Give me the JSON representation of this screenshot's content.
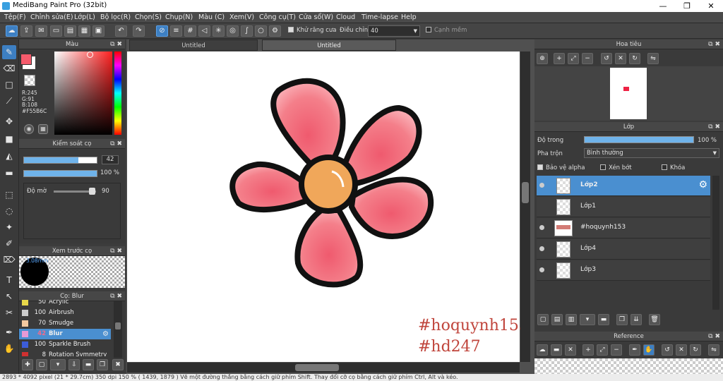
{
  "window": {
    "title": "MediBang Paint Pro (32bit)",
    "minimize": "—",
    "maximize": "❐",
    "close": "✕"
  },
  "menu": [
    "Tệp(F)",
    "Chỉnh sửa(E)",
    "Lớp(L)",
    "Bộ lọc(R)",
    "Chọn(S)",
    "Chụp(N)",
    "Màu (C)",
    "Xem(V)",
    "Công cụ(T)",
    "Cửa sổ(W)",
    "Cloud",
    "Time-lapse",
    "Help"
  ],
  "toolbar": {
    "antialias_label": "Khử răng cưa",
    "antialias_checked": true,
    "correction_label": "Điều chỉnh",
    "correction_value": "40",
    "edge_label": "Cạnh mềm",
    "edge_checked": false
  },
  "color_panel": {
    "title": "Màu",
    "r": "R:245",
    "g": "G:91",
    "b": "B:108",
    "hex": "#F55B6C",
    "primary_color": "#f55b6c",
    "secondary_color": "#ffffff"
  },
  "brush_control": {
    "title": "Kiểm soát cọ",
    "size_value": "42",
    "opacity_value": "100 %",
    "density_label": "Độ mờ",
    "density_value": "90",
    "size_fraction": 0.75,
    "opacity_fraction": 1.0,
    "density_fraction": 0.9
  },
  "brush_preview": {
    "title": "Xem trước cọ",
    "size_text": "3.08mm"
  },
  "brush_list": {
    "title": "Cọ: Blur",
    "items": [
      {
        "size": "50",
        "name": "Acrylic",
        "color": "#e8d84a"
      },
      {
        "size": "100",
        "name": "Airbrush",
        "color": "#cccccc"
      },
      {
        "size": "70",
        "name": "Smudge",
        "color": "#f3c9a0"
      },
      {
        "size": "42",
        "name": "Blur",
        "color": "#e79ad6",
        "active": true
      },
      {
        "size": "100",
        "name": "Sparkle Brush",
        "color": "#3c5cd8"
      },
      {
        "size": "8",
        "name": "Rotation Symmetry Pe",
        "color": "#d03030"
      }
    ]
  },
  "tabs": [
    {
      "label": "Untitled"
    },
    {
      "label": "Untitled",
      "active": true
    }
  ],
  "canvas": {
    "watermark_line1": "#hoquynh153",
    "watermark_line2": "#hd247",
    "watermark_color": "#c0453c",
    "petal_color": "#f47f8a",
    "center_color": "#f0a75a"
  },
  "navigator": {
    "title": "Hoa tiêu"
  },
  "layer_panel": {
    "title": "Lớp",
    "opacity_label": "Độ trong",
    "opacity_value": "100 %",
    "blend_label": "Pha trộn",
    "blend_value": "Bình thường",
    "protect_alpha": "Bảo vệ alpha",
    "clipping": "Xén bớt",
    "lock": "Khóa",
    "layers": [
      {
        "name": "Lớp2",
        "active": true,
        "visible": true
      },
      {
        "name": "Lớp1",
        "active": false,
        "visible": false
      },
      {
        "name": "#hoquynh153",
        "active": false,
        "visible": true
      },
      {
        "name": "Lớp4",
        "active": false,
        "visible": true
      },
      {
        "name": "Lớp3",
        "active": false,
        "visible": true
      }
    ]
  },
  "reference": {
    "title": "Reference"
  },
  "status": "2893 * 4092 pixel  (21 * 29.7cm)  350 dpi  150 %  ( 1439, 1879 )  Vẽ một đường thẳng bằng cách giữ phím Shift. Thay đổi cỡ cọ bằng cách giữ phím Ctrl, Alt và kéo."
}
